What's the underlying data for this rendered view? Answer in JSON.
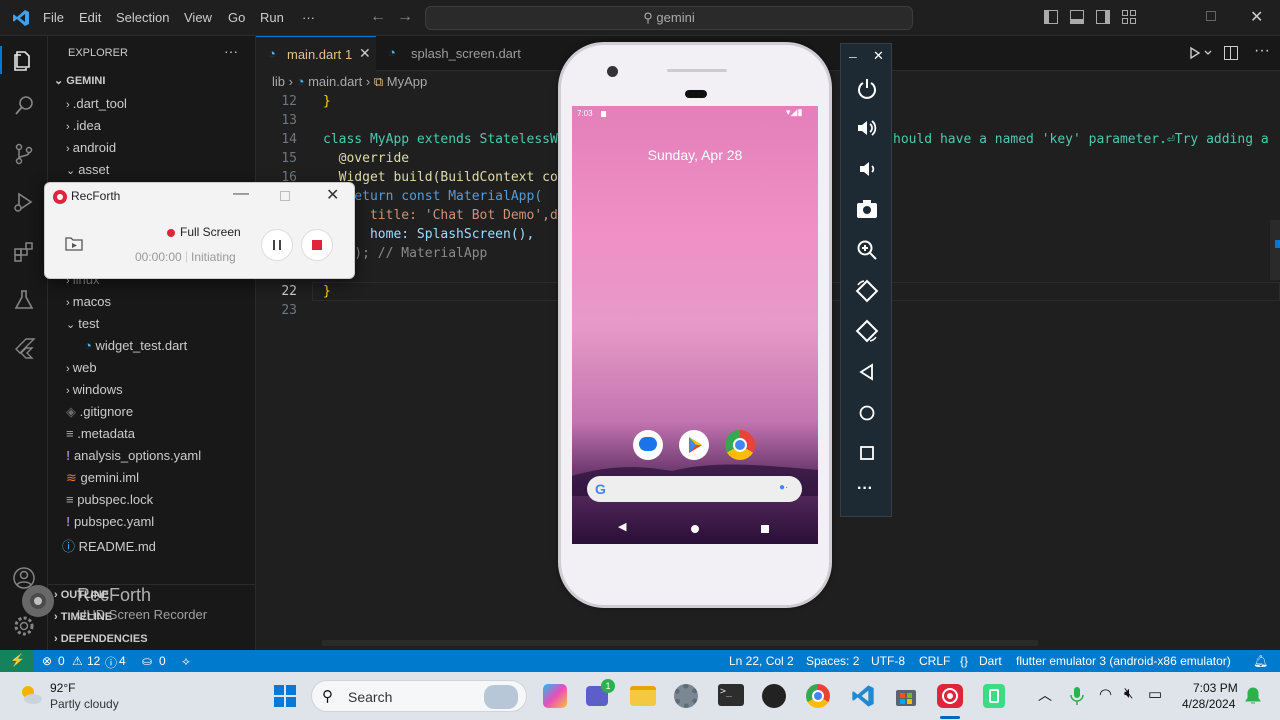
{
  "titlebar": {
    "menus": [
      "File",
      "Edit",
      "Selection",
      "View",
      "Go",
      "Run",
      "···"
    ],
    "search_text": "gemini"
  },
  "sidebar": {
    "header": "EXPLORER",
    "more": "···",
    "root": "GEMINI",
    "items": [
      {
        "label": ".dart_tool",
        "kind": "folder"
      },
      {
        "label": ".idea",
        "kind": "folder"
      },
      {
        "label": "android",
        "kind": "folder"
      },
      {
        "label": "asset",
        "kind": "folder-open"
      },
      {
        "label": "linux",
        "kind": "folder"
      },
      {
        "label": "macos",
        "kind": "folder"
      },
      {
        "label": "test",
        "kind": "folder-open"
      },
      {
        "label": "widget_test.dart",
        "kind": "dart"
      },
      {
        "label": "web",
        "kind": "folder"
      },
      {
        "label": "windows",
        "kind": "folder"
      },
      {
        "label": ".gitignore",
        "kind": "git"
      },
      {
        "label": ".metadata",
        "kind": "lines"
      },
      {
        "label": "analysis_options.yaml",
        "kind": "yaml"
      },
      {
        "label": "gemini.iml",
        "kind": "rss"
      },
      {
        "label": "pubspec.lock",
        "kind": "lines"
      },
      {
        "label": "pubspec.yaml",
        "kind": "yaml"
      },
      {
        "label": "README.md",
        "kind": "info"
      }
    ],
    "sections": [
      "OUTLINE",
      "TIMELINE",
      "DEPENDENCIES"
    ]
  },
  "tabs": [
    {
      "label": "main.dart",
      "badge": "1",
      "active": true
    },
    {
      "label": "splash_screen.dart",
      "active": false
    }
  ],
  "breadcrumb": {
    "parts": [
      "lib",
      "main.dart",
      "MyApp"
    ]
  },
  "code": {
    "lines": [
      {
        "n": "12",
        "text": "}"
      },
      {
        "n": "13",
        "text": ""
      },
      {
        "n": "14",
        "text": "class MyApp extends StatelessWi"
      },
      {
        "n": "15",
        "text": "  @override"
      },
      {
        "n": "16",
        "text": "  Widget build(BuildContext con"
      },
      {
        "n": "17",
        "text": "   return const MaterialApp("
      },
      {
        "n": "18",
        "text": "      title: 'Chat Bot Demo',de"
      },
      {
        "n": "19",
        "text": "      home: SplashScreen(),"
      },
      {
        "n": "20",
        "text": "    ); // MaterialApp"
      },
      {
        "n": "21",
        "text": ""
      },
      {
        "n": "22",
        "text": "}"
      },
      {
        "n": "23",
        "text": ""
      }
    ],
    "inline_hint": "hould have a named 'key' parameter.⏎Try adding a"
  },
  "recforth": {
    "title": "RecForth",
    "mode": "Full Screen",
    "time": "00:00:00",
    "status": "Initiating"
  },
  "watermark": {
    "brand": "RecForth",
    "tagline": "UHD Screen Recorder"
  },
  "phone": {
    "status_time": "7:03",
    "date": "Sunday, Apr 28"
  },
  "statusbar": {
    "errors": "0",
    "warnings": "12",
    "infos": "4",
    "ports": "0",
    "position": "Ln 22, Col 2",
    "spaces": "Spaces: 2",
    "encoding": "UTF-8",
    "eol": "CRLF",
    "language": "Dart",
    "device": "flutter emulator 3 (android-x86 emulator)"
  },
  "taskbar": {
    "temp": "92°F",
    "weather": "Partly cloudy",
    "search": "Search",
    "time": "7:03 PM",
    "date": "4/28/2024",
    "badge": "1"
  },
  "colors": {
    "accent": "#007acc",
    "rec_red": "#e0243b",
    "keyword": "#569cd6",
    "type": "#4ec9b0",
    "string": "#ce9178"
  }
}
